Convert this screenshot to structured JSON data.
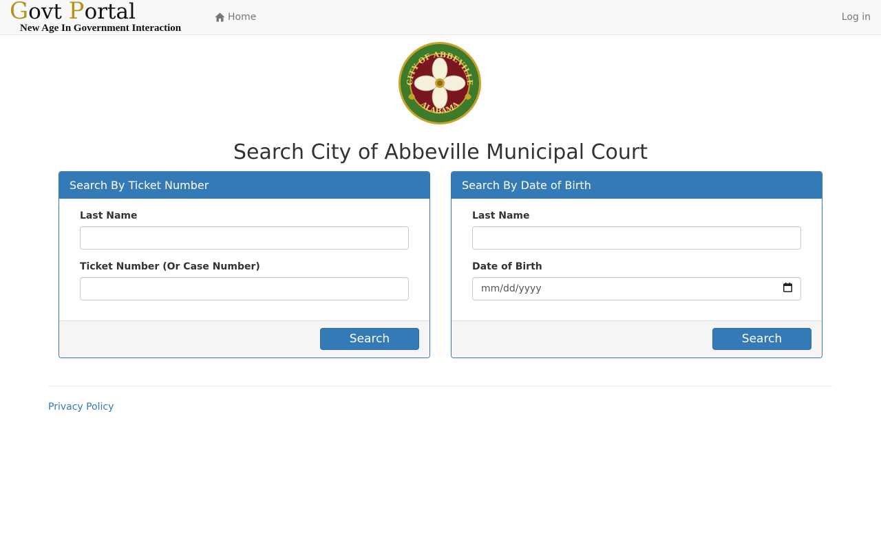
{
  "navbar": {
    "brand_first_initial": "G",
    "brand_first_rest": "ovt ",
    "brand_second_initial": "P",
    "brand_second_rest": "ortal",
    "brand_subtitle": "New Age In Government Interaction",
    "home_icon": "home-icon",
    "home_label": "Home",
    "login_label": "Log in"
  },
  "seal": {
    "name": "city-seal",
    "top_text": "CITY OF ABBEVILLE",
    "bottom_text": "ALABAMA",
    "colors": {
      "outer": "#3d7a2a",
      "ring": "#7a1621",
      "gold": "#c8a32c",
      "petal": "#f4f0dc"
    }
  },
  "page": {
    "title": "Search City of Abbeville Municipal Court"
  },
  "ticket_panel": {
    "heading": "Search By Ticket Number",
    "last_name_label": "Last Name",
    "last_name_value": "",
    "ticket_label": "Ticket Number (Or Case Number)",
    "ticket_value": "",
    "search_label": "Search"
  },
  "dob_panel": {
    "heading": "Search By Date of Birth",
    "last_name_label": "Last Name",
    "last_name_value": "",
    "dob_label": "Date of Birth",
    "dob_placeholder": "mm/dd/yyyy",
    "calendar_icon": "calendar-icon",
    "search_label": "Search"
  },
  "footer": {
    "privacy_label": "Privacy Policy"
  },
  "theme": {
    "primary": "#337ab7",
    "navbar_bg": "#f8f8f8",
    "brand_gold": "#b8921f"
  }
}
